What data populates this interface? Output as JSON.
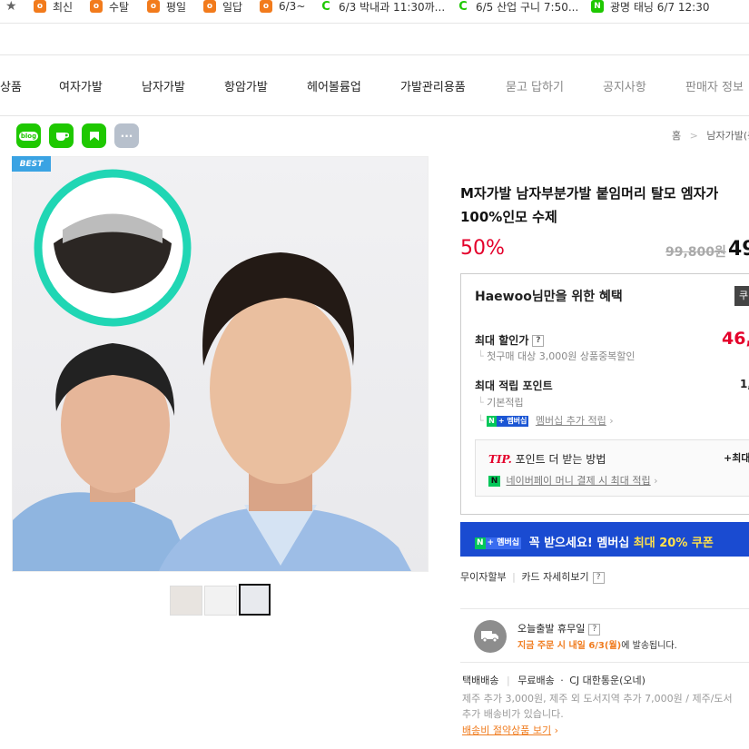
{
  "bookmarks": [
    {
      "label": "★",
      "icon": "star-icon"
    },
    {
      "label": "최신",
      "icon": "orange-o-icon"
    },
    {
      "label": "수탈",
      "icon": "orange-o-icon"
    },
    {
      "label": "평일",
      "icon": "orange-o-icon"
    },
    {
      "label": "일답",
      "icon": "orange-o-icon"
    },
    {
      "label": "6/3~",
      "icon": "orange-o-icon"
    },
    {
      "label": "6/3 박내과 11:30까...",
      "icon": "green-c-icon"
    },
    {
      "label": "6/5 산업 구니 7:50...",
      "icon": "green-c-icon"
    },
    {
      "label": "광명 태닝 6/7 12:30",
      "icon": "naver-n-icon"
    }
  ],
  "nav": [
    "상품",
    "여자가발",
    "남자가발",
    "항암가발",
    "헤어볼륨업",
    "가발관리용품",
    "묻고 답하기",
    "공지사항",
    "판매자 정보"
  ],
  "share": [
    "blog",
    "cafe",
    "N",
    "···"
  ],
  "breadcrumb": {
    "home": "홈",
    "sep": ">",
    "current": "남자가발(총"
  },
  "badge": "BEST",
  "product": {
    "title_line1": "M자가발 남자부분가발 붙임머리 탈모 엠자가",
    "title_line2": "100%인모 수제",
    "discount": "50%",
    "original_price": "99,800원",
    "sale_price": "49"
  },
  "benefit": {
    "header": "Haewoo님만을 위한 혜택",
    "header_button": "쿠",
    "max_discount_label": "최대 할인가",
    "max_discount_value": "46,",
    "max_discount_note": "첫구매 대상 3,000원 상품중복할인",
    "max_points_label": "최대 적립 포인트",
    "max_points_value": "1,",
    "base_points": "기본적립",
    "membership_points": "멤버십 추가 적립",
    "npay_n": "N",
    "npay_m": "+ 멤버십"
  },
  "tip": {
    "tip_label": "TIP.",
    "tip_text": "포인트 더 받는 방법",
    "tip_right": "+최대",
    "tip_link": "네이버페이 머니 결제 시 최대 적립"
  },
  "banner": {
    "n": "N",
    "m": "+ 멤버십",
    "text_white": "꼭 받으세요! 멤버십",
    "text_yellow": "최대 20% 쿠폰"
  },
  "payment": {
    "installment": "무이자할부",
    "card": "카드 자세히보기"
  },
  "delivery": {
    "title": "오늘출발 휴무일",
    "note_orange": "지금 주문 시 내일 6/3(월)",
    "note_rest": "에 발송됩니다."
  },
  "shipping": {
    "type": "택배배송",
    "free": "무료배송",
    "carrier": "CJ 대한통운(오네)",
    "extra_line1": "제주 추가 3,000원, 제주 외 도서지역 추가 7,000원 / 제주/도서",
    "extra_line2": "추가 배송비가 있습니다.",
    "save_link": "배송비 절약상품 보기"
  },
  "colors": {
    "accent_red": "#e4002b",
    "naver_green": "#03c75a",
    "membership_blue": "#1a4bd1",
    "best_blue": "#3aa3e3"
  }
}
